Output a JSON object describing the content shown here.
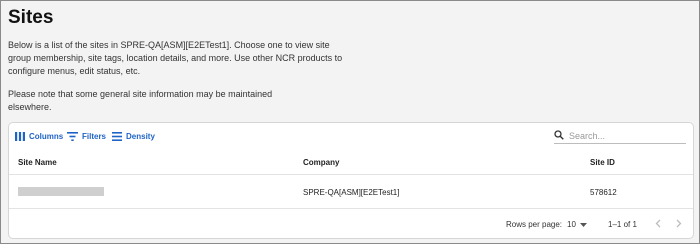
{
  "page": {
    "title": "Sites",
    "intro": "Below is a list of the sites in SPRE-QA[ASM][E2ETest1]. Choose one to view site group membership, site tags, location details, and more. Use other NCR products to configure menus, edit status, etc.",
    "note": "Please note that some general site information may be maintained elsewhere."
  },
  "toolbar": {
    "columns_label": "Columns",
    "filters_label": "Filters",
    "density_label": "Density",
    "search_placeholder": "Search..."
  },
  "table": {
    "headers": [
      "Site Name",
      "Company",
      "Site ID"
    ],
    "rows": [
      {
        "site_name": "",
        "company": "SPRE-QA[ASM][E2ETest1]",
        "site_id": "578612"
      }
    ]
  },
  "footer": {
    "rows_per_page_label": "Rows per page:",
    "rows_per_page_value": "10",
    "range_text": "1–1 of 1"
  },
  "colors": {
    "accent": "#1f63c6",
    "background": "#f3f3f3",
    "grid_background": "#ffffff"
  },
  "icons": [
    "columns-icon",
    "filter-icon",
    "density-icon",
    "search-icon",
    "dropdown-arrow-icon",
    "chevron-left-icon",
    "chevron-right-icon"
  ]
}
